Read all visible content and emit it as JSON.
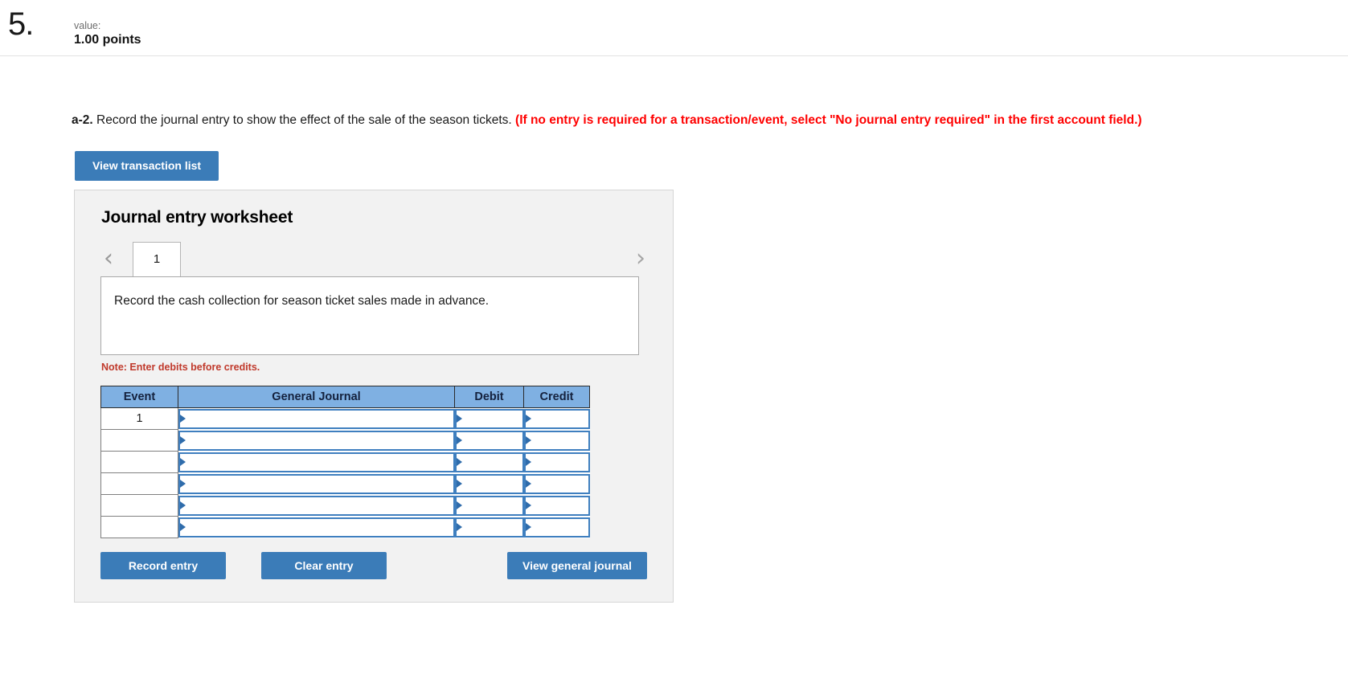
{
  "header": {
    "question_number": "5.",
    "value_label": "value:",
    "points": "1.00 points"
  },
  "question": {
    "prefix": "a-2.",
    "text": "Record the journal entry to show the effect of the sale of the season tickets.",
    "red_hint": "(If no entry is required for a transaction/event, select \"No journal entry required\" in the first account field.)"
  },
  "toolbar": {
    "view_transaction_list": "View transaction list"
  },
  "worksheet": {
    "title": "Journal entry worksheet",
    "prev_icon": "‹",
    "next_icon": "›",
    "tabs": [
      {
        "label": "1",
        "active": true
      }
    ],
    "instruction": "Record the cash collection for season ticket sales made in advance.",
    "note": "Note: Enter debits before credits.",
    "table": {
      "columns": [
        "Event",
        "General Journal",
        "Debit",
        "Credit"
      ],
      "rows": [
        {
          "event": "1",
          "general_journal": "",
          "debit": "",
          "credit": ""
        },
        {
          "event": "",
          "general_journal": "",
          "debit": "",
          "credit": ""
        },
        {
          "event": "",
          "general_journal": "",
          "debit": "",
          "credit": ""
        },
        {
          "event": "",
          "general_journal": "",
          "debit": "",
          "credit": ""
        },
        {
          "event": "",
          "general_journal": "",
          "debit": "",
          "credit": ""
        },
        {
          "event": "",
          "general_journal": "",
          "debit": "",
          "credit": ""
        }
      ]
    },
    "buttons": {
      "record_entry": "Record entry",
      "clear_entry": "Clear entry",
      "view_general_journal": "View general journal"
    }
  },
  "colors": {
    "button_blue": "#3b7cb8",
    "table_header_blue": "#7fb0e2",
    "field_border_blue": "#3f7fbf",
    "hint_red": "#ff0000",
    "note_red": "#c0392b",
    "panel_gray": "#f2f2f2"
  }
}
